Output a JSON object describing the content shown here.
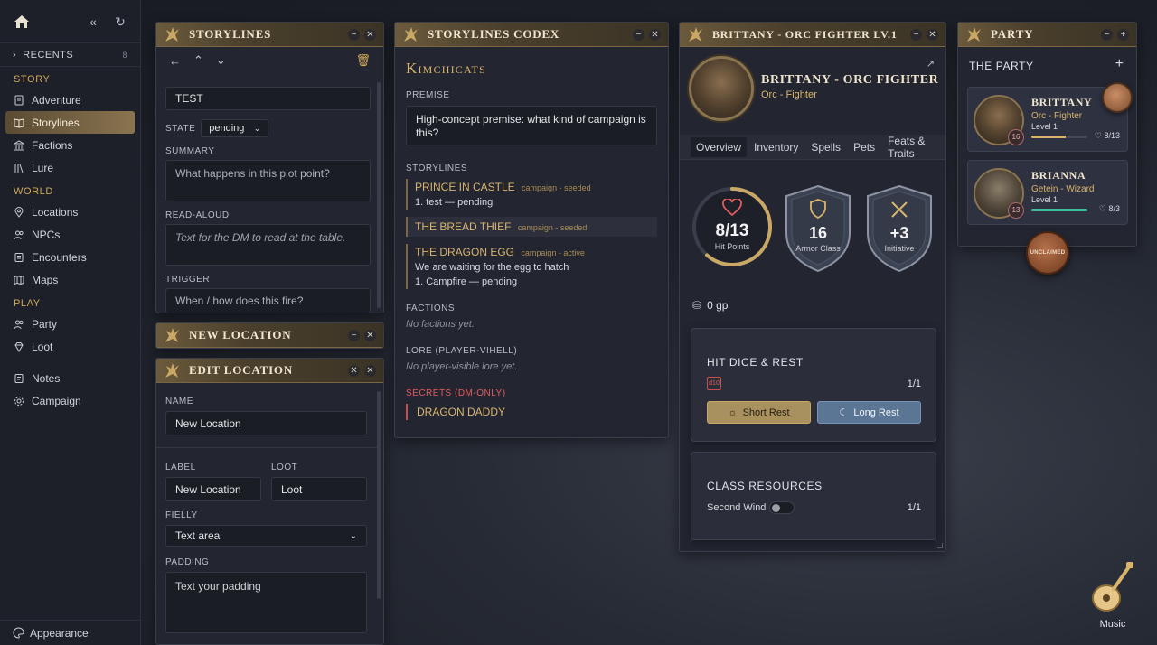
{
  "sidebar": {
    "recents": {
      "label": "RECENTS",
      "count": "8"
    },
    "sections": {
      "story": "STORY",
      "world": "WORLD",
      "play": "PLAY"
    },
    "story_items": [
      "Adventure",
      "Storylines",
      "Factions",
      "Lure"
    ],
    "world_items": [
      "Locations",
      "NPCs",
      "Encounters",
      "Maps"
    ],
    "play_items": [
      "Party",
      "Loot"
    ],
    "other_items": [
      "Notes",
      "Campaign"
    ],
    "appearance": "Appearance"
  },
  "storylines": {
    "title": "STORYLINES",
    "name_value": "TEST",
    "state_label": "STATE",
    "state_value": "pending",
    "summary_label": "SUMMARY",
    "summary_placeholder": "What happens in this plot point?",
    "readaloud_label": "READ-ALOUD",
    "readaloud_placeholder": "Text for the DM to read at the table.",
    "trigger_label": "TRIGGER",
    "trigger_placeholder": "When / how does this fire?"
  },
  "new_location": {
    "title": "NEW LOCATION"
  },
  "edit_location": {
    "title": "EDIT LOCATION",
    "name_label": "NAME",
    "name_value": "New Location",
    "label_label": "LABEL",
    "label_value": "New Location",
    "loot_label": "LOOT",
    "loot_value": "Loot",
    "fields_label": "FIELLY",
    "fields_value": "Text area",
    "padding_label": "PADDING",
    "padding_placeholder": "Text your padding"
  },
  "codex": {
    "title": "STORYLINES CODEX",
    "campaign": "Kimchicats",
    "premise_label": "PREMISE",
    "premise_text": "High-concept premise: what kind of campaign is this?",
    "storylines_label": "STORYLINES",
    "stories": [
      {
        "name": "PRINCE IN CASTLE",
        "tag": "campaign - seeded",
        "lines": [
          "1. test — pending"
        ]
      },
      {
        "name": "THE BREAD THIEF",
        "tag": "campaign - seeded",
        "lines": []
      },
      {
        "name": "THE DRAGON EGG",
        "tag": "campaign - active",
        "lines": [
          "We are waiting for the egg to hatch",
          "1. Campfire — pending"
        ]
      }
    ],
    "factions_label": "FACTIONS",
    "factions_empty": "No factions yet.",
    "lore_label": "LORE (PLAYER-VIHELL)",
    "lore_empty": "No player-visible lore yet.",
    "secrets_label": "SECRETS (DM-ONLY)",
    "secret_item": "DRAGON DADDY"
  },
  "character": {
    "window_title": "BRITTANY - ORC FIGHTER LV.1",
    "name": "BRITTANY - ORC FIGHTER",
    "subtitle": "Orc - Fighter",
    "tabs": [
      "Overview",
      "Inventory",
      "Spells",
      "Pets",
      "Feats & Traits"
    ],
    "hp_value": "8/13",
    "hp_label": "Hit Points",
    "hp_fraction": 0.615,
    "ac_value": "16",
    "ac_label": "Armor Class",
    "init_value": "+3",
    "init_label": "Initiative",
    "gold": "0 gp",
    "hitdice": {
      "title": "HIT DICE & REST",
      "die": "d10",
      "count": "1/1",
      "short": "Short Rest",
      "long": "Long Rest"
    },
    "resources": {
      "title": "CLASS RESOURCES",
      "name": "Second Wind",
      "count": "1/1"
    }
  },
  "party": {
    "title": "PARTY",
    "heading": "THE PARTY",
    "members": [
      {
        "name": "BRITTANY",
        "class": "Orc - Fighter",
        "level": "Level 1",
        "badge": "16",
        "hp": "8/13",
        "hp_fraction": 0.62,
        "bar_color": "#d9b46d"
      },
      {
        "name": "BRIANNA",
        "class": "Getein - Wizard",
        "level": "Level 1",
        "badge": "13",
        "hp": "8/3",
        "hp_fraction": 1.0,
        "bar_color": "#3fbf9c"
      }
    ],
    "unclaimed": "UNCLAIMED"
  },
  "music": {
    "label": "Music"
  }
}
